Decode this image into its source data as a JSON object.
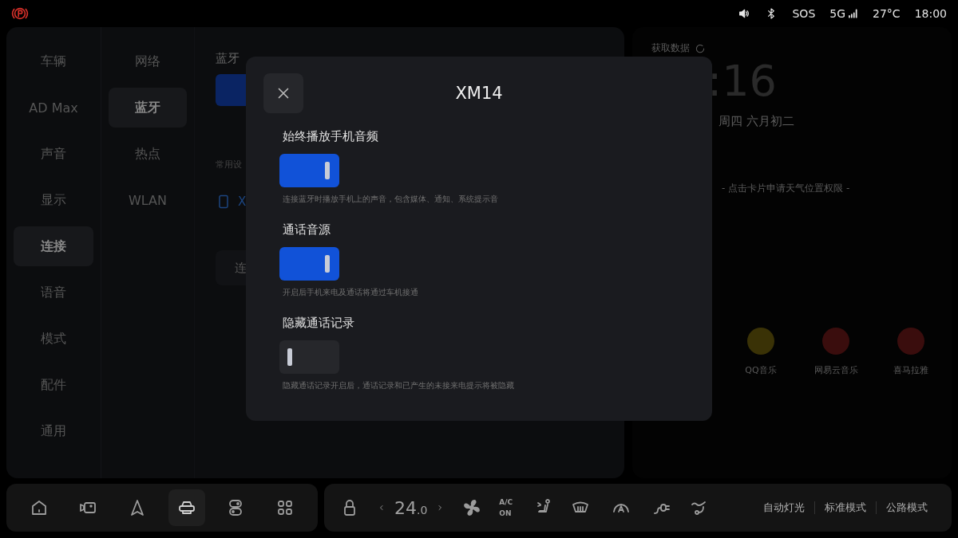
{
  "status_bar": {
    "sos": "SOS",
    "network": "5G",
    "temperature": "27°C",
    "time": "18:00"
  },
  "nav": [
    {
      "label": "车辆",
      "selected": false
    },
    {
      "label": "AD Max",
      "selected": false
    },
    {
      "label": "声音",
      "selected": false
    },
    {
      "label": "显示",
      "selected": false
    },
    {
      "label": "连接",
      "selected": true
    },
    {
      "label": "语音",
      "selected": false
    },
    {
      "label": "模式",
      "selected": false
    },
    {
      "label": "配件",
      "selected": false
    },
    {
      "label": "通用",
      "selected": false
    }
  ],
  "subnav": [
    {
      "label": "网络",
      "selected": false
    },
    {
      "label": "蓝牙",
      "selected": true
    },
    {
      "label": "热点",
      "selected": false
    },
    {
      "label": "WLAN",
      "selected": false
    }
  ],
  "content": {
    "title": "蓝牙",
    "bluetooth_on": true,
    "section_label": "常用设",
    "device": "X",
    "button": "连"
  },
  "home_card": {
    "status": "获取数据",
    "clock": ":16",
    "date": "周四  六月初二",
    "weather_hint": "- 点击卡片申请天气位置权限 -",
    "apps": [
      {
        "label": "QQ音乐",
        "color": "#3a3206"
      },
      {
        "label": "网易云音乐",
        "color": "#3a0d0d"
      },
      {
        "label": "喜马拉雅",
        "color": "#3a0d0d"
      }
    ]
  },
  "dialog": {
    "title": "XM14",
    "toggles": [
      {
        "label": "始终播放手机音频",
        "on": true,
        "description": "连接蓝牙时播放手机上的声音，包含媒体、通知、系统提示音"
      },
      {
        "label": "通话音源",
        "on": true,
        "description": "开启后手机来电及通话将通过车机接通"
      },
      {
        "label": "隐藏通话记录",
        "on": false,
        "description": "隐藏通话记录开启后，通话记录和已产生的未接来电提示将被隐藏"
      }
    ]
  },
  "dock": {
    "apps": [
      {
        "kind": "home",
        "selected": false
      },
      {
        "kind": "camera",
        "selected": false
      },
      {
        "kind": "navigation",
        "selected": false
      },
      {
        "kind": "car",
        "selected": true
      },
      {
        "kind": "switches",
        "selected": false
      },
      {
        "kind": "apps",
        "selected": false
      }
    ],
    "temperature": "24",
    "temperature_decimal": ".0",
    "ac_label": "A/C ON",
    "modes": [
      "自动灯光",
      "标准模式",
      "公路模式"
    ]
  }
}
